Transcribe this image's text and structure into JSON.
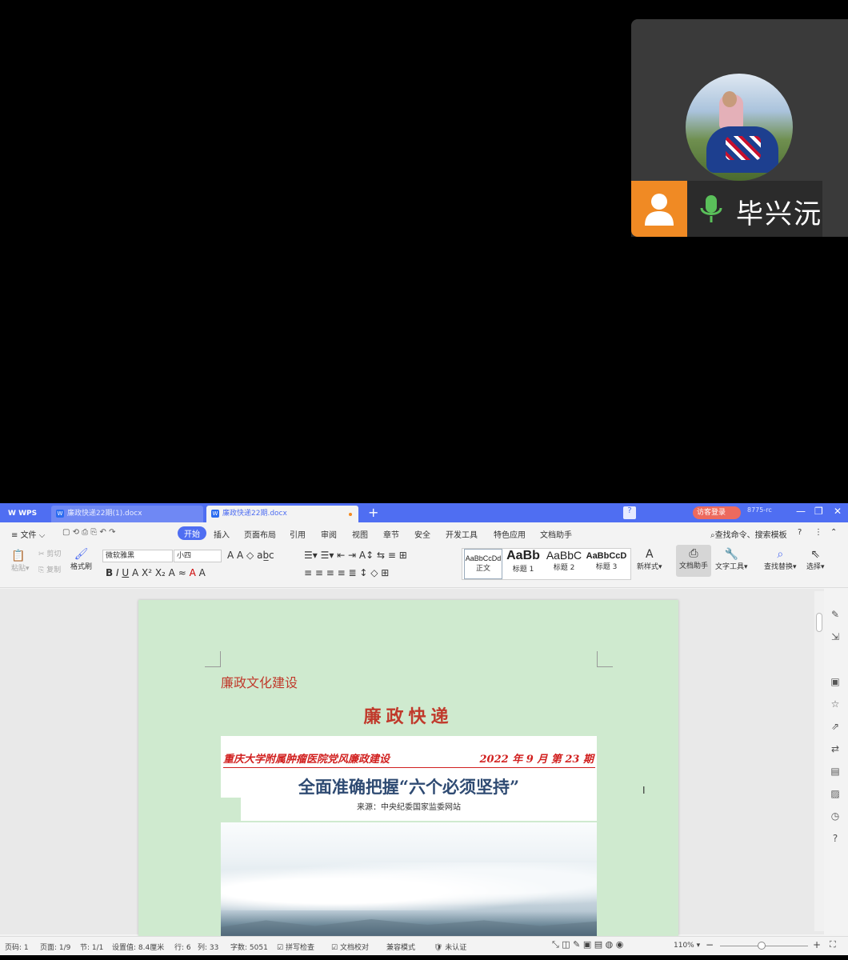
{
  "call": {
    "participant_name": "毕兴沅",
    "user_icon": "user-icon",
    "mic_icon": "microphone-icon"
  },
  "titlebar": {
    "app_label": "WPS",
    "tabs": [
      {
        "label": "廉政快递22期(1).docx",
        "active": false
      },
      {
        "label": "廉政快递22期.docx",
        "active": true
      }
    ],
    "new_tab_label": "+",
    "help_label": "?",
    "visitor_label": "访客登录",
    "account_label": "8775-rc",
    "minimize": "—",
    "restore": "❐",
    "close": "✕"
  },
  "menubar": {
    "file_label": "文件",
    "items": [
      "开始",
      "插入",
      "页面布局",
      "引用",
      "审阅",
      "视图",
      "章节",
      "安全",
      "开发工具",
      "特色应用",
      "文档助手"
    ],
    "search_label": "查找命令、搜索模板",
    "help": "?",
    "more": "⋮",
    "collapse": "⌃"
  },
  "ribbon": {
    "paste": "粘贴",
    "cut": "剪切",
    "copy": "复制",
    "format_painter": "格式刷",
    "font_name": "微软雅黑",
    "font_size": "小四",
    "styles": [
      {
        "preview": "AaBbCcDd",
        "label": "正文"
      },
      {
        "preview": "AaBb",
        "label": "标题 1"
      },
      {
        "preview": "AaBbC",
        "label": "标题 2"
      },
      {
        "preview": "AaBbCcD",
        "label": "标题 3"
      }
    ],
    "new_style": "新样式",
    "doc_assistant": "文档助手",
    "text_tools": "文字工具",
    "find_replace": "查找替换",
    "select": "选择"
  },
  "document": {
    "section_title": "廉政文化建设",
    "masthead": "廉政快递",
    "banner_org": "重庆大学附属肿瘤医院党风廉政建设",
    "banner_issue": "2022 年 9 月   第 23 期",
    "headline": "全面准确把握“六个必须坚持”",
    "source": "来源：中央纪委国家监委网站"
  },
  "statusbar": {
    "page_num": "页码: 1",
    "pages": "页面: 1/9",
    "section": "节: 1/1",
    "setting": "设置值: 8.4厘米",
    "row": "行: 6",
    "col": "列: 33",
    "word_count": "字数: 5051",
    "spell_check": "拼写检查",
    "doc_proof": "文档校对",
    "compat_mode": "兼容模式",
    "cert": "未认证",
    "zoom": "110%",
    "zoom_level": 0.47
  }
}
